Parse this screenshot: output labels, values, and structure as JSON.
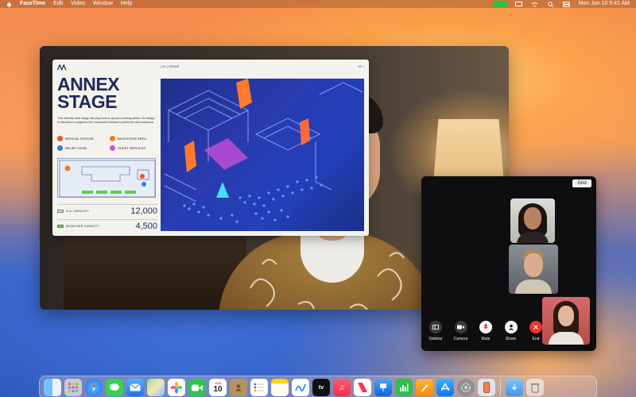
{
  "menubar": {
    "app_name": "FaceTime",
    "menus": [
      "Edit",
      "Video",
      "Window",
      "Help"
    ],
    "clock": "Mon Jun 10 9:41 AM"
  },
  "slide": {
    "logo": "ᐱᐱ",
    "venue_label": "| 01 | VENUE",
    "page_num": "02 ↑",
    "title_line1": "ANNEX",
    "title_line2": "STAGE",
    "description": "This intimate side stage will play host to up-and-coming artists. Its design is intended to augment the connection between performer and audience.",
    "legend": [
      {
        "label": "MEDICAL STATION",
        "color": "#e8562a"
      },
      {
        "label": "BACKSTAGE AREA",
        "color": "#ef7a2a"
      },
      {
        "label": "RELIEF KIOSK",
        "color": "#2f7fe0"
      },
      {
        "label": "GUEST SERVICES",
        "color": "#d94fd3"
      }
    ],
    "stats": [
      {
        "label": "G.A. CAPACITY",
        "value": "12,000",
        "swatch": "#cfe0f6"
      },
      {
        "label": "BLEACHER CAPACITY",
        "value": "4,500",
        "swatch": "#5fcf52"
      }
    ]
  },
  "participants": {
    "grid_label": "Grid",
    "controls": [
      {
        "label": "Sidebar",
        "icon": "sidebar-icon",
        "color": "#3a3a3d"
      },
      {
        "label": "Camera",
        "icon": "camera-icon",
        "color": "#3a3a3d"
      },
      {
        "label": "Mute",
        "icon": "microphone-icon",
        "color": "#ffffff"
      },
      {
        "label": "Share",
        "icon": "share-person-icon",
        "color": "#ffffff"
      },
      {
        "label": "End",
        "icon": "close-icon",
        "color": "#e8332e"
      }
    ]
  },
  "dock": {
    "calendar_month": "JUN",
    "calendar_day": "10",
    "apps": [
      "Finder",
      "Launchpad",
      "Safari",
      "Messages",
      "Mail",
      "Maps",
      "Photos",
      "FaceTime",
      "Calendar",
      "Contacts",
      "Reminders",
      "Notes",
      "Freeform",
      "TV",
      "Music",
      "News",
      "Keynote",
      "Numbers",
      "Pages",
      "App Store",
      "System Settings",
      "iPhone Mirroring",
      "Downloads",
      "Trash"
    ]
  }
}
